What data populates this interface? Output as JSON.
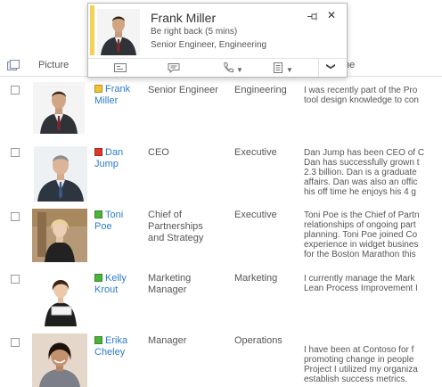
{
  "header": {
    "picture_label": "Picture",
    "about_label": "me"
  },
  "rows": [
    {
      "name": "Frank\nMiller",
      "presence": "#f1c232",
      "title": "Senior Engineer",
      "department": "Engineering",
      "about": "I was recently part of the Pro\ntool design knowledge to con"
    },
    {
      "name": "Dan\nJump",
      "presence": "#d9382a",
      "title": "CEO",
      "department": "Executive",
      "about": "Dan Jump has been CEO of C\nDan has successfully grown t\n2.3 billion. Dan is a graduate\naffairs. Dan was also an offic\nhis off time he enjoys his 4 g"
    },
    {
      "name": "Toni\nPoe",
      "presence": "#4cb33b",
      "title": "Chief of\nPartnerships\nand Strategy",
      "department": "Executive",
      "about": "Toni Poe is the Chief of Partn\nrelationships of ongoing part\nplanning. Toni Poe joined Co\nexperience in widget busines\nfor the Boston Marathon this"
    },
    {
      "name": "Kelly\nKrout",
      "presence": "#4cb33b",
      "title": "Marketing\nManager",
      "department": "Marketing",
      "about": "I currently manage the Mark\nLean Process Improvement I"
    },
    {
      "name": "Erika\nCheley",
      "presence": "#4cb33b",
      "title": "Manager",
      "department": "Operations",
      "about": "\nI have been at Contoso for f\npromoting change in people\nProject I utilized my organiza\nestablish success metrics."
    }
  ],
  "callout": {
    "name": "Frank Miller",
    "status": "Be right back (5 mins)",
    "role": "Senior Engineer, Engineering",
    "close_glyph": "✕",
    "more_glyph": "❯"
  },
  "colors": {
    "link": "#2c7cc9",
    "away": "#f1c232",
    "busy": "#d9382a",
    "available": "#4cb33b"
  }
}
